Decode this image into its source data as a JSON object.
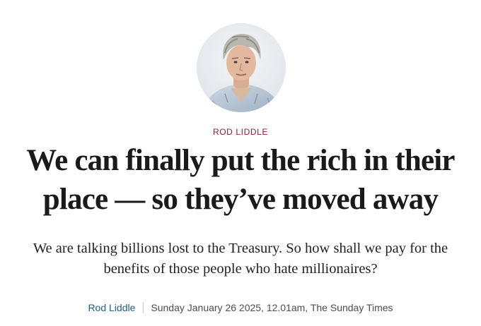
{
  "article": {
    "kicker": "ROD LIDDLE",
    "headline": "We can finally put the rich in their place — so they’ve moved away",
    "standfirst": "We are talking billions lost to the Treasury. So how shall we pay for the benefits of those people who hate millionaires?",
    "author": "Rod Liddle",
    "dateline": "Sunday January 26 2025, 12.01am, The Sunday Times"
  },
  "colors": {
    "kicker": "#8c1d3c",
    "author_link": "#1f5f8b",
    "headline": "#1a1a1a",
    "meta_text": "#4d4d4d"
  },
  "icons": {
    "author_photo": "author-portrait"
  }
}
